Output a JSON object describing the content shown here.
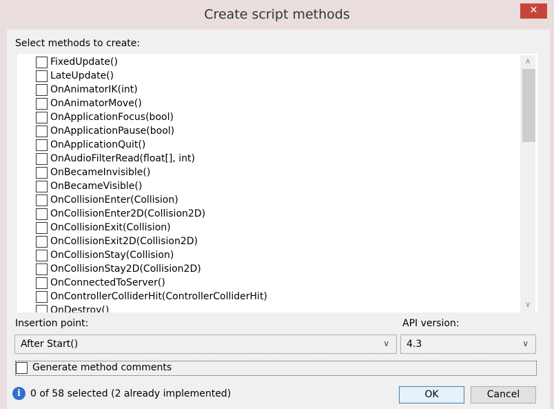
{
  "window": {
    "title": "Create script methods",
    "close_symbol": "✕"
  },
  "methods_label": "Select methods to create:",
  "methods": [
    "FixedUpdate()",
    "LateUpdate()",
    "OnAnimatorIK(int)",
    "OnAnimatorMove()",
    "OnApplicationFocus(bool)",
    "OnApplicationPause(bool)",
    "OnApplicationQuit()",
    "OnAudioFilterRead(float[], int)",
    "OnBecameInvisible()",
    "OnBecameVisible()",
    "OnCollisionEnter(Collision)",
    "OnCollisionEnter2D(Collision2D)",
    "OnCollisionExit(Collision)",
    "OnCollisionExit2D(Collision2D)",
    "OnCollisionStay(Collision)",
    "OnCollisionStay2D(Collision2D)",
    "OnConnectedToServer()",
    "OnControllerColliderHit(ControllerColliderHit)",
    "OnDestroy()"
  ],
  "scroll": {
    "up_symbol": "∧",
    "down_symbol": "∨"
  },
  "insertion": {
    "label": "Insertion point:",
    "value": "After Start()"
  },
  "api": {
    "label": "API version:",
    "value": "4.3"
  },
  "dropdown_symbol": "∨",
  "generate_comments_label": "Generate method comments",
  "status": {
    "icon": "info-icon",
    "text": "0 of 58 selected (2 already implemented)"
  },
  "buttons": {
    "ok": "OK",
    "cancel": "Cancel"
  }
}
